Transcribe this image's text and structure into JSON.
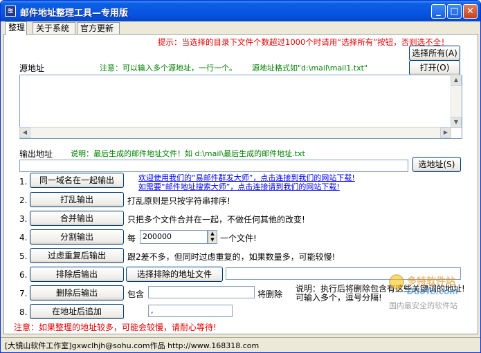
{
  "window": {
    "title": "邮件地址整理工具—专用版",
    "minimize": "_",
    "maximize": "□",
    "close": "✕"
  },
  "tabs": [
    "整理",
    "关于系统",
    "官方更新"
  ],
  "hint_top": "提示：当选择的目录下文件个数超过1000个时请用“选择所有”按钮，否则选不全！",
  "source": {
    "label": "源地址",
    "note": "注意：可以输入多个源地址，一行一个。",
    "format_note": "源地址格式如\"d:\\mail\\mail1.txt\"",
    "select_all_btn": "选择所有(A)",
    "open_btn": "打开(O)"
  },
  "output": {
    "label": "输出地址",
    "note": "说明：最后生成的邮件地址文件！如 d:\\mail\\最后生成的邮件地址.txt",
    "value": "",
    "select_btn": "选地址(S)"
  },
  "rows": [
    {
      "num": "1.",
      "button": "同一域名在一起输出"
    },
    {
      "num": "2.",
      "button": "打乱输出",
      "desc": "打乱原则是只按字符串排序!"
    },
    {
      "num": "3.",
      "button": "合并输出",
      "desc": "只把多个文件合并在一起，不做任何其他的改变!"
    },
    {
      "num": "4.",
      "button": "分割输出",
      "prefix": "每",
      "spin_value": "200000",
      "suffix": "一个文件!"
    },
    {
      "num": "5.",
      "button": "过虑重复后输出",
      "desc": "跟2差不多，但同时过虑重复的，如果数量多，可能较慢!"
    },
    {
      "num": "6.",
      "button": "排除后输出",
      "sub_button": "选择排除的地址文件",
      "field_value": ""
    },
    {
      "num": "7.",
      "button": "删除后输出",
      "prefix": "包含",
      "field_value": "",
      "suffix": "将删除"
    },
    {
      "num": "8.",
      "button": "在地址后追加",
      "field_value": ","
    }
  ],
  "links": [
    "欢迎使用我们的“易邮件群发大师”，点击连接到我们的网站下载!",
    "如需要“邮件地址搜索大师”，点击连接请到我们的网站下载!"
  ],
  "row7_note": "说明：执行后将删除包含有这些关键词的地址!\n可输入多个，逗号分隔!",
  "warning": "注意：如果整理的地址较多，可能会较慢，请耐心等待!",
  "status": "[大镜山软件工作室]gxwclhjh@sohu.com作品  http://www.168318.com",
  "watermark": {
    "brand": "多特软件站",
    "url": "DuoTe.com",
    "tagline": "国内最安全的软件站"
  }
}
